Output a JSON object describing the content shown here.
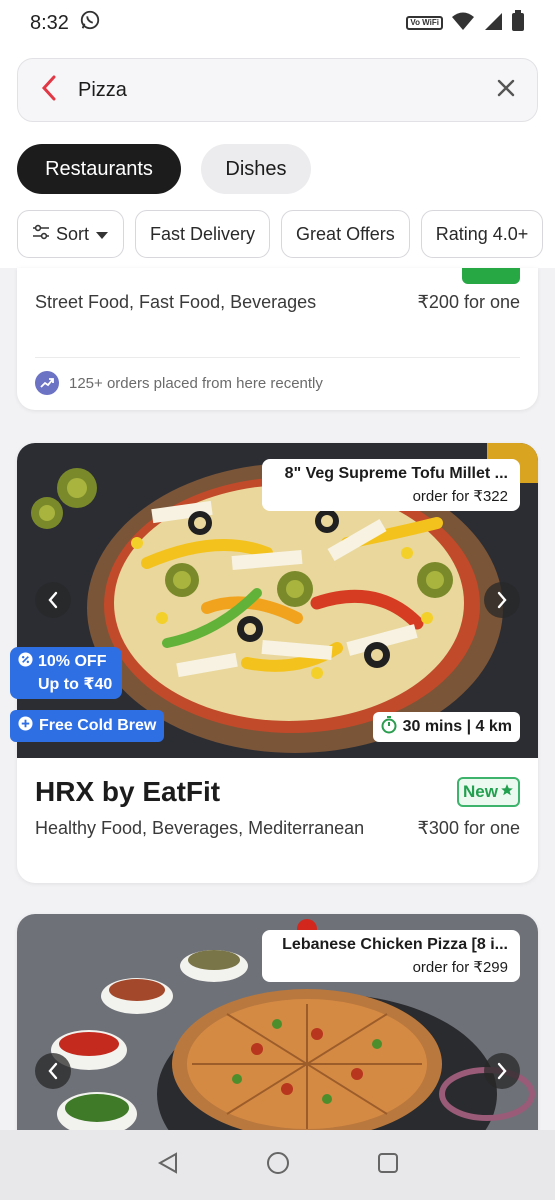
{
  "status": {
    "time": "8:32",
    "vowifi": "Vo WiFi"
  },
  "search": {
    "query": "Pizza"
  },
  "tabs": [
    {
      "label": "Restaurants",
      "active": true
    },
    {
      "label": "Dishes",
      "active": false
    }
  ],
  "filters": {
    "sort_label": "Sort",
    "items": [
      "Fast Delivery",
      "Great Offers",
      "Rating 4.0+"
    ]
  },
  "card_prev": {
    "cuisines": "Street Food, Fast Food, Beverages",
    "price": "₹200 for one",
    "orders_note": "125+ orders placed from here recently"
  },
  "card_hrx": {
    "dish_name": "8\" Veg Supreme Tofu Millet ...",
    "dish_price": "order for ₹322",
    "offer_line1": "10% OFF",
    "offer_line2": "Up to ₹40",
    "free_item": "Free Cold Brew",
    "time_distance": "30 mins | 4 km",
    "name": "HRX by EatFit",
    "badge": "New",
    "cuisines": "Healthy Food, Beverages, Mediterranean",
    "price": "₹300 for one"
  },
  "card_next": {
    "dish_name": "Lebanese Chicken Pizza [8 i...",
    "dish_price": "order for ₹299"
  },
  "colors": {
    "accent_red": "#e23744",
    "offer_blue": "#2f6fe4",
    "new_green": "#22a04f"
  }
}
